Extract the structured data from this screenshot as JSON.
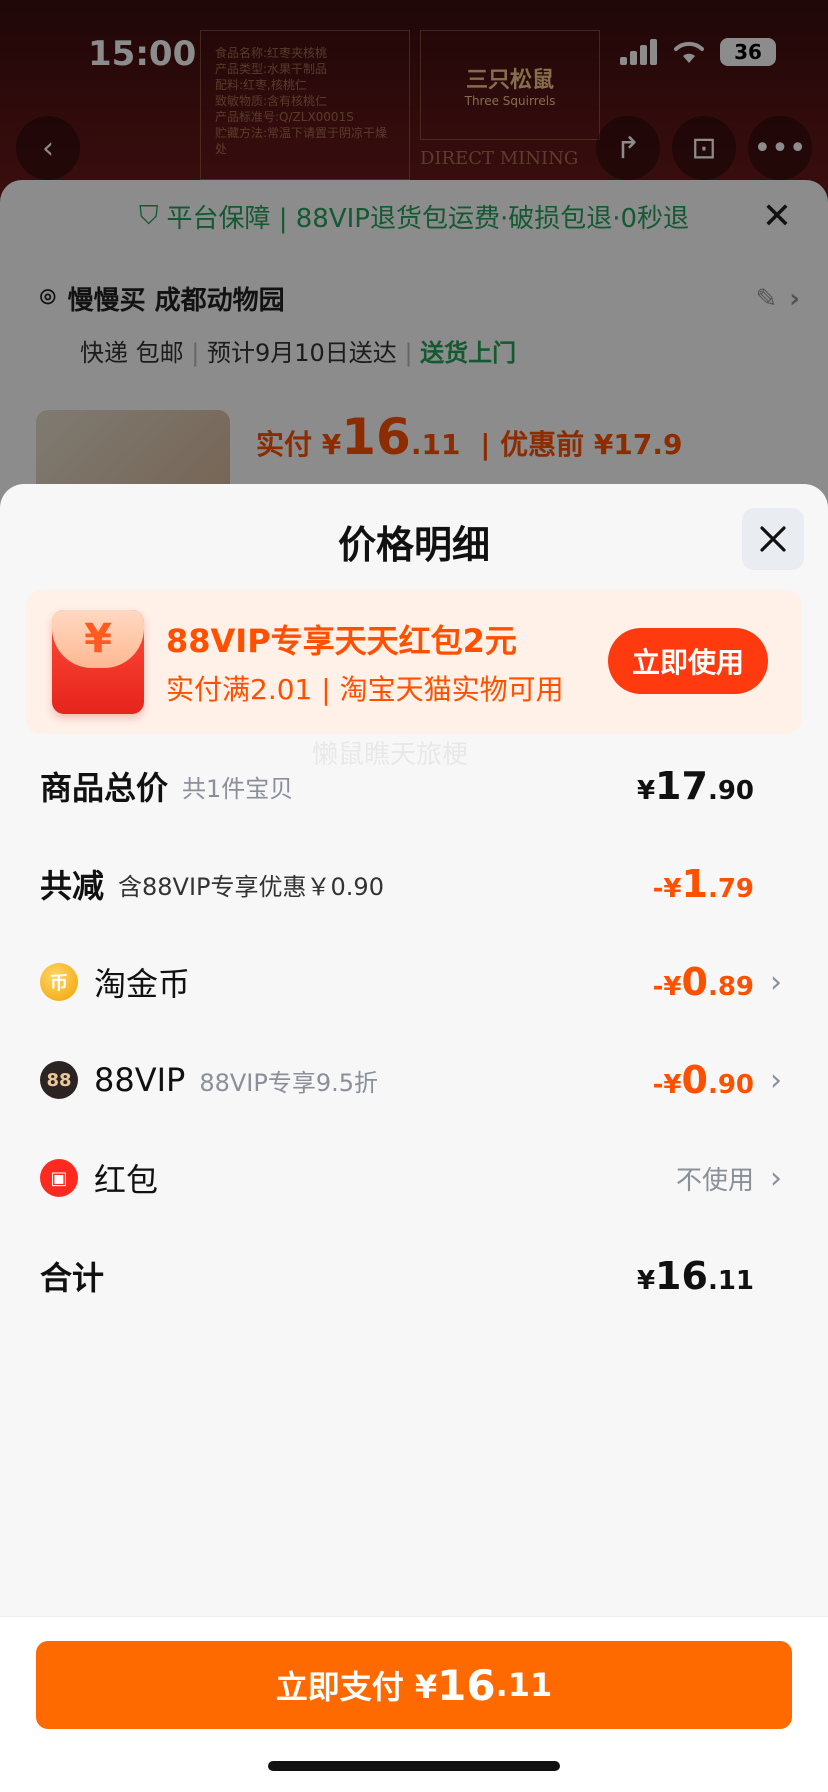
{
  "status": {
    "time": "15:00",
    "battery": "36"
  },
  "banner": {
    "info_lines": [
      "食品名称:红枣夹核桃",
      "产品类型:水果干制品",
      "配料:红枣,核桃仁",
      "致敏物质:含有核桃仁",
      "产品标准号:Q/ZLX0001S",
      "贮藏方法:常温下请置于阴凉干燥处"
    ],
    "brand_name": "三只松鼠",
    "brand_en": "Three Squirrels",
    "brand_strip": "DIRECT MINING"
  },
  "guarantee": {
    "text": "平台保障 | 88VIP退货包运费·破损包退·0秒退"
  },
  "address": {
    "name": "慢慢买 成都动物园",
    "shipping": "快递 包邮",
    "eta": "预计9月10日送达",
    "delivery": "送货上门"
  },
  "preview": {
    "prefix": "实付 ¥",
    "price_int": "16",
    "price_dec": ".11",
    "before_label": "| 优惠前 ¥17.9"
  },
  "sheet": {
    "title": "价格明细",
    "promo": {
      "icon_glyph": "¥",
      "title": "88VIP专享天天红包2元",
      "subtitle": "实付满2.01 | 淘宝天猫实物可用",
      "button": "立即使用"
    },
    "watermark": "懒鼠瞧天旅梗",
    "rows": {
      "total": {
        "label": "商品总价",
        "sub": "共1件宝贝",
        "currency": "¥",
        "int": "17",
        "dec": ".90"
      },
      "reduce": {
        "label": "共减",
        "sub": "含88VIP专享优惠￥0.90",
        "currency": "-¥",
        "int": "1",
        "dec": ".79"
      },
      "coins": {
        "icon_glyph": "币",
        "label": "淘金币",
        "currency": "-¥",
        "int": "0",
        "dec": ".89",
        "icon": "coin-icon"
      },
      "vip": {
        "icon_glyph": "88",
        "label": "88VIP",
        "sub": "88VIP专享9.5折",
        "currency": "-¥",
        "int": "0",
        "dec": ".90",
        "icon": "vip-icon"
      },
      "hongbao": {
        "icon_glyph": "▣",
        "label": "红包",
        "value": "不使用",
        "icon": "hongbao-icon"
      },
      "sum": {
        "label": "合计",
        "currency": "¥",
        "int": "16",
        "dec": ".11"
      }
    },
    "pay": {
      "label": "立即支付 ¥",
      "int": "16",
      "dec": ".11"
    }
  },
  "colors": {
    "accent": "#ff5000",
    "pay_button": "#ff6a00",
    "promo_button": "#ff3a0f",
    "guarantee_green": "#23a35a"
  }
}
